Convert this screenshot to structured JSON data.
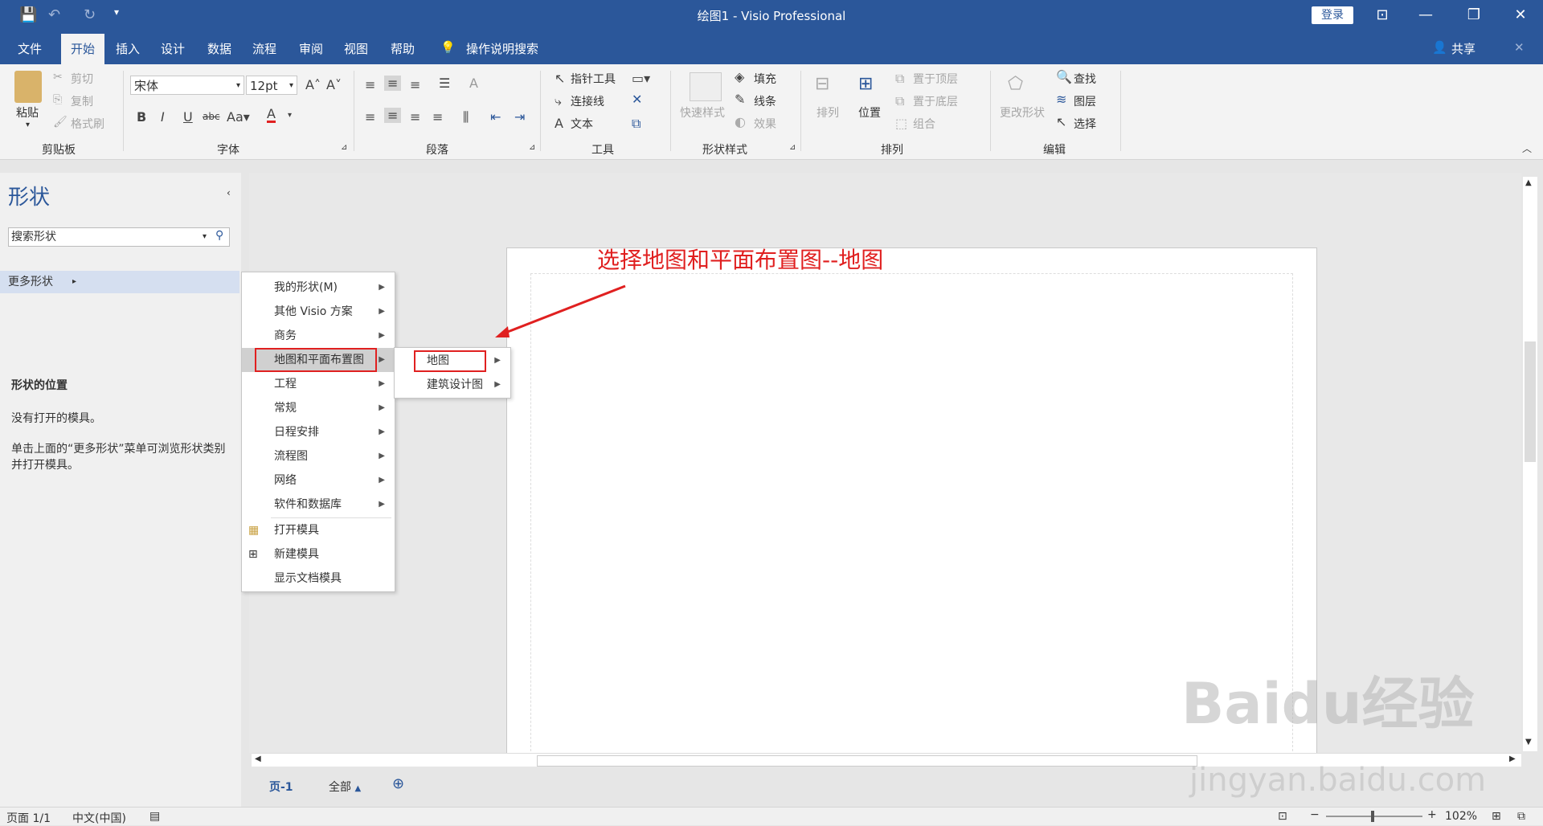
{
  "window": {
    "title": "绘图1  -  Visio Professional",
    "login_label": "登录",
    "share_label": "共享",
    "tell_me": "操作说明搜索"
  },
  "tabs": [
    "文件",
    "开始",
    "插入",
    "设计",
    "数据",
    "流程",
    "审阅",
    "视图",
    "帮助"
  ],
  "ribbon": {
    "clipboard": {
      "paste": "粘贴",
      "cut": "剪切",
      "copy": "复制",
      "format_painter": "格式刷",
      "group": "剪贴板"
    },
    "font": {
      "font_name": "宋体",
      "font_size": "12pt",
      "group": "字体"
    },
    "paragraph": {
      "group": "段落"
    },
    "tools": {
      "pointer": "指针工具",
      "connector": "连接线",
      "text": "文本",
      "group": "工具"
    },
    "shape_styles": {
      "quick_styles": "快速样式",
      "fill": "填充",
      "line": "线条",
      "effects": "效果",
      "group": "形状样式"
    },
    "arrange": {
      "arrange": "排列",
      "position": "位置",
      "bring_front": "置于顶层",
      "send_back": "置于底层",
      "group_cmd": "组合",
      "group": "排列"
    },
    "editing": {
      "change_shape": "更改形状",
      "find": "查找",
      "layers": "图层",
      "select": "选择",
      "group": "编辑"
    }
  },
  "shapes_pane": {
    "title": "形状",
    "search_value": "搜索形状",
    "more_shapes": "更多形状",
    "location_heading": "形状的位置",
    "no_stencil": "没有打开的模具。",
    "hint": "单击上面的“更多形状”菜单可浏览形状类别并打开模具。"
  },
  "menu": {
    "items": [
      "我的形状(M)",
      "其他 Visio 方案",
      "商务",
      "地图和平面布置图",
      "工程",
      "常规",
      "日程安排",
      "流程图",
      "网络",
      "软件和数据库",
      "打开模具",
      "新建模具",
      "显示文档模具"
    ]
  },
  "submenu": {
    "items": [
      "地图",
      "建筑设计图"
    ]
  },
  "annotation": "选择地图和平面布置图--地图",
  "sheet": {
    "page_tab": "页-1",
    "all_label": "全部"
  },
  "status": {
    "page": "页面 1/1",
    "language": "中文(中国)",
    "zoom": "102%"
  },
  "watermark": {
    "logo": "Baidu经验",
    "url": "jingyan.baidu.com"
  },
  "colors": {
    "titlebar": "#2b579a",
    "annotation": "#e02020",
    "ribbon": "#f3f3f3"
  }
}
